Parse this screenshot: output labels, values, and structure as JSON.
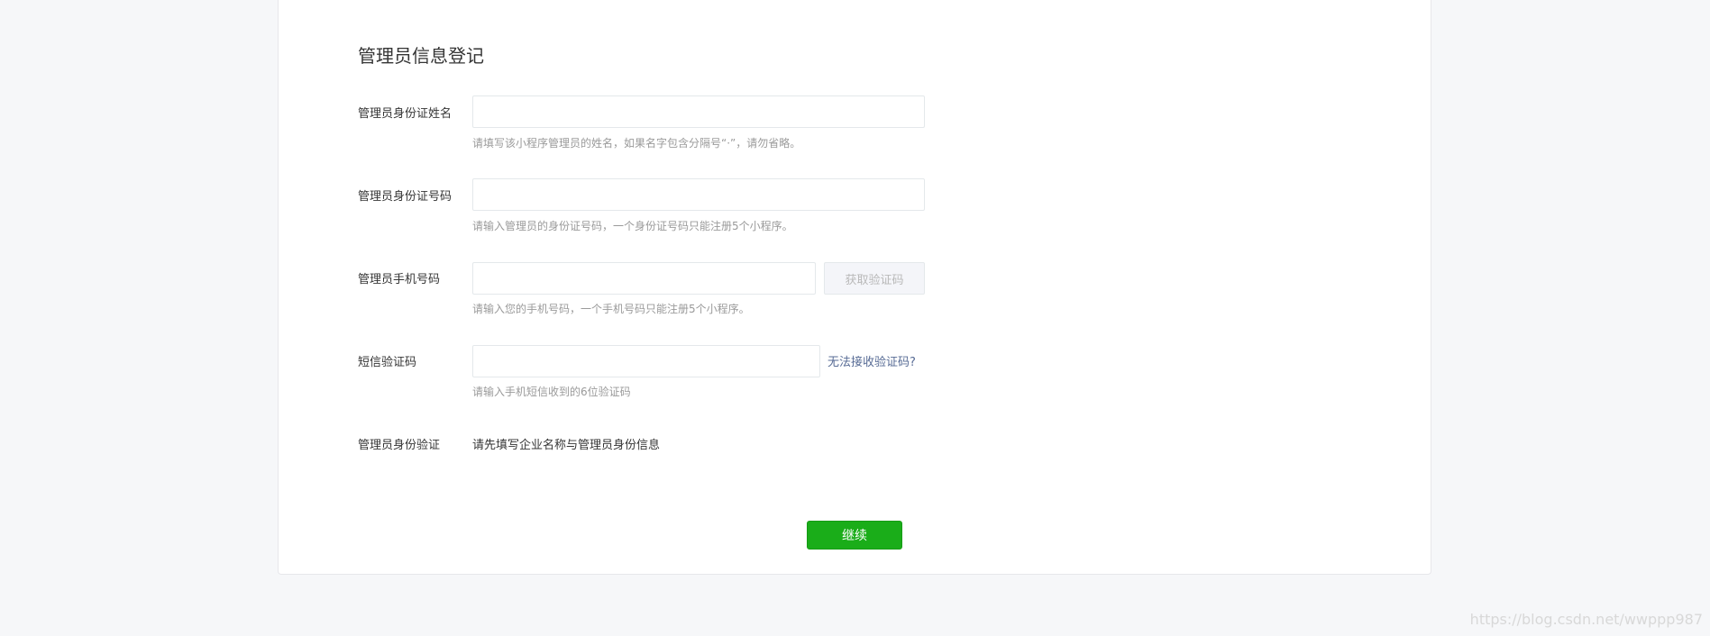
{
  "form": {
    "title": "管理员信息登记",
    "name_field": {
      "label": "管理员身份证姓名",
      "value": "",
      "hint": "请填写该小程序管理员的姓名，如果名字包含分隔号“·”，请勿省略。"
    },
    "id_field": {
      "label": "管理员身份证号码",
      "value": "",
      "hint": "请输入管理员的身份证号码，一个身份证号码只能注册5个小程序。"
    },
    "phone_field": {
      "label": "管理员手机号码",
      "value": "",
      "hint": "请输入您的手机号码，一个手机号码只能注册5个小程序。",
      "get_code_label": "获取验证码"
    },
    "sms_field": {
      "label": "短信验证码",
      "value": "",
      "hint": "请输入手机短信收到的6位验证码",
      "help_link": "无法接收验证码?"
    },
    "identity_verify": {
      "label": "管理员身份验证",
      "text": "请先填写企业名称与管理员身份信息"
    },
    "continue_label": "继续"
  },
  "watermark": "https://blog.csdn.net/wwppp987",
  "colors": {
    "primary_green": "#1aad19",
    "link_blue": "#576b95",
    "page_background": "#f6f7f9"
  }
}
